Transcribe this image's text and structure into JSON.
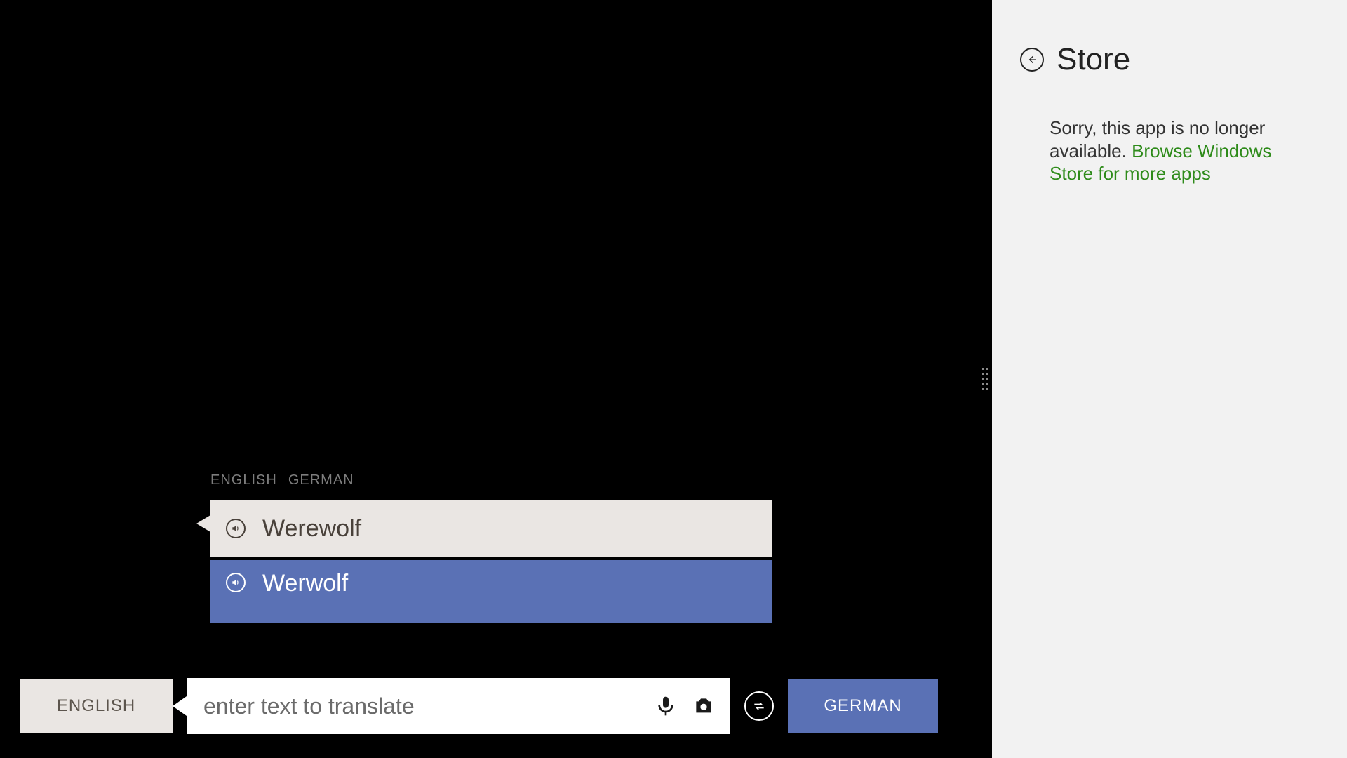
{
  "translator": {
    "pair": {
      "source": "English",
      "target": "German"
    },
    "source_text": "Werewolf",
    "target_text": "Werwolf",
    "input": {
      "placeholder": "enter text to translate",
      "value": ""
    },
    "buttons": {
      "source_lang": "English",
      "target_lang": "German"
    }
  },
  "store": {
    "title": "Store",
    "message_prefix": "Sorry, this app is no longer available. ",
    "link_text": "Browse Windows Store for more apps"
  }
}
